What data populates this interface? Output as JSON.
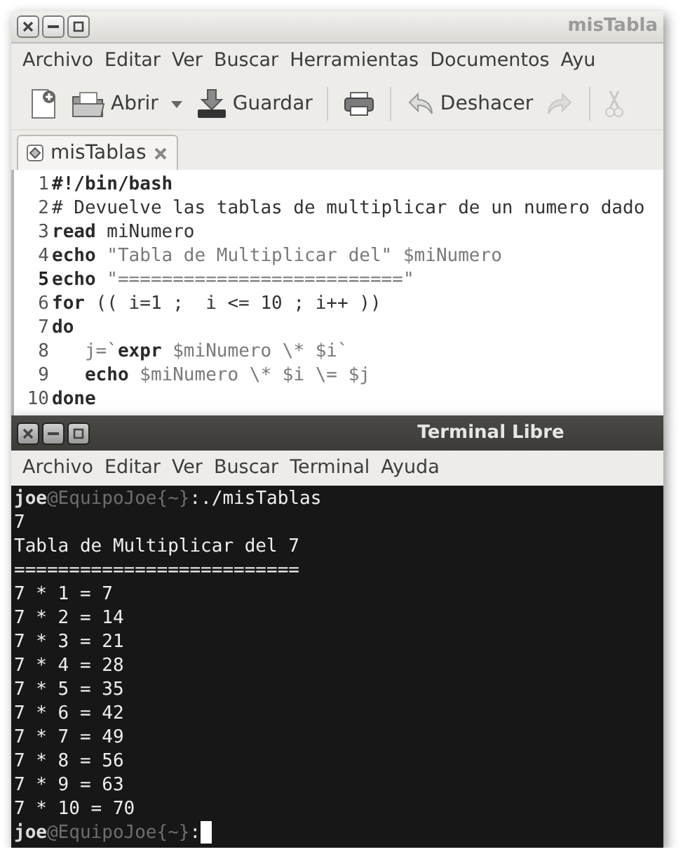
{
  "editor_window": {
    "title": "misTabla",
    "window_buttons": [
      {
        "kind": "close"
      },
      {
        "kind": "minimize"
      },
      {
        "kind": "maximize"
      }
    ],
    "menu": [
      "Archivo",
      "Editar",
      "Ver",
      "Buscar",
      "Herramientas",
      "Documentos",
      "Ayu"
    ],
    "toolbar": [
      {
        "kind": "new",
        "disabled": false
      },
      {
        "kind": "open",
        "label": "Abrir",
        "disabled": false
      },
      {
        "kind": "dropdown",
        "disabled": false
      },
      {
        "kind": "save",
        "label": "Guardar",
        "disabled": false
      },
      {
        "kind": "separator"
      },
      {
        "kind": "print",
        "disabled": false
      },
      {
        "kind": "separator"
      },
      {
        "kind": "undo",
        "label": "Deshacer",
        "disabled": false
      },
      {
        "kind": "redo",
        "disabled": true
      },
      {
        "kind": "separator"
      },
      {
        "kind": "cut",
        "disabled": true
      }
    ],
    "tabs": [
      {
        "label": "misTablas",
        "selected": true
      }
    ],
    "code": [
      {
        "number": "1",
        "current": false,
        "segments": [
          {
            "text": "#!/bin/bash",
            "kind": "keyword"
          }
        ]
      },
      {
        "number": "2",
        "current": false,
        "segments": [
          {
            "text": "# Devuelve las tablas de multiplicar de un numero dado",
            "kind": "plain"
          }
        ]
      },
      {
        "number": "3",
        "current": false,
        "segments": [
          {
            "text": "read",
            "kind": "keyword"
          },
          {
            "text": " miNumero",
            "kind": "plain"
          }
        ]
      },
      {
        "number": "4",
        "current": false,
        "segments": [
          {
            "text": "echo",
            "kind": "keyword"
          },
          {
            "text": " \"Tabla de Multiplicar del\" $miNumero",
            "kind": "string"
          }
        ]
      },
      {
        "number": "5",
        "current": true,
        "segments": [
          {
            "text": "echo",
            "kind": "keyword"
          },
          {
            "text": " \"==========================\"",
            "kind": "string"
          }
        ]
      },
      {
        "number": "6",
        "current": false,
        "segments": [
          {
            "text": "for",
            "kind": "keyword"
          },
          {
            "text": " (( i=1 ;  i <= 10 ; i++ ))",
            "kind": "plain"
          }
        ]
      },
      {
        "number": "7",
        "current": false,
        "segments": [
          {
            "text": "do",
            "kind": "keyword"
          }
        ]
      },
      {
        "number": "8",
        "current": false,
        "segments": [
          {
            "text": "   j=`",
            "kind": "string"
          },
          {
            "text": "expr",
            "kind": "keyword"
          },
          {
            "text": " $miNumero \\* $i`",
            "kind": "string"
          }
        ]
      },
      {
        "number": "9",
        "current": false,
        "segments": [
          {
            "text": "   echo",
            "kind": "keyword"
          },
          {
            "text": " $miNumero \\* $i \\= $j",
            "kind": "string"
          }
        ]
      },
      {
        "number": "10",
        "current": false,
        "segments": [
          {
            "text": "done",
            "kind": "keyword"
          }
        ]
      }
    ]
  },
  "terminal_window": {
    "title": "Terminal Libre",
    "window_buttons": [
      {
        "kind": "close"
      },
      {
        "kind": "minimize"
      },
      {
        "kind": "maximize"
      }
    ],
    "menu": [
      "Archivo",
      "Editar",
      "Ver",
      "Buscar",
      "Terminal",
      "Ayuda"
    ],
    "lines": [
      {
        "cursor": false,
        "segments": [
          {
            "text": "joe",
            "kind": "bold"
          },
          {
            "text": "@EquipoJoe{~}",
            "kind": "dim"
          },
          {
            "text": ":./misTablas",
            "kind": "plain"
          }
        ]
      },
      {
        "cursor": false,
        "segments": [
          {
            "text": "7",
            "kind": "plain"
          }
        ]
      },
      {
        "cursor": false,
        "segments": [
          {
            "text": "Tabla de Multiplicar del 7",
            "kind": "plain"
          }
        ]
      },
      {
        "cursor": false,
        "segments": [
          {
            "text": "==========================",
            "kind": "plain"
          }
        ]
      },
      {
        "cursor": false,
        "segments": [
          {
            "text": "7 * 1 = 7",
            "kind": "plain"
          }
        ]
      },
      {
        "cursor": false,
        "segments": [
          {
            "text": "7 * 2 = 14",
            "kind": "plain"
          }
        ]
      },
      {
        "cursor": false,
        "segments": [
          {
            "text": "7 * 3 = 21",
            "kind": "plain"
          }
        ]
      },
      {
        "cursor": false,
        "segments": [
          {
            "text": "7 * 4 = 28",
            "kind": "plain"
          }
        ]
      },
      {
        "cursor": false,
        "segments": [
          {
            "text": "7 * 5 = 35",
            "kind": "plain"
          }
        ]
      },
      {
        "cursor": false,
        "segments": [
          {
            "text": "7 * 6 = 42",
            "kind": "plain"
          }
        ]
      },
      {
        "cursor": false,
        "segments": [
          {
            "text": "7 * 7 = 49",
            "kind": "plain"
          }
        ]
      },
      {
        "cursor": false,
        "segments": [
          {
            "text": "7 * 8 = 56",
            "kind": "plain"
          }
        ]
      },
      {
        "cursor": false,
        "segments": [
          {
            "text": "7 * 9 = 63",
            "kind": "plain"
          }
        ]
      },
      {
        "cursor": false,
        "segments": [
          {
            "text": "7 * 10 = 70",
            "kind": "plain"
          }
        ]
      },
      {
        "cursor": true,
        "segments": [
          {
            "text": "joe",
            "kind": "bold"
          },
          {
            "text": "@EquipoJoe{~}",
            "kind": "dim"
          },
          {
            "text": ":",
            "kind": "plain"
          }
        ]
      }
    ]
  }
}
